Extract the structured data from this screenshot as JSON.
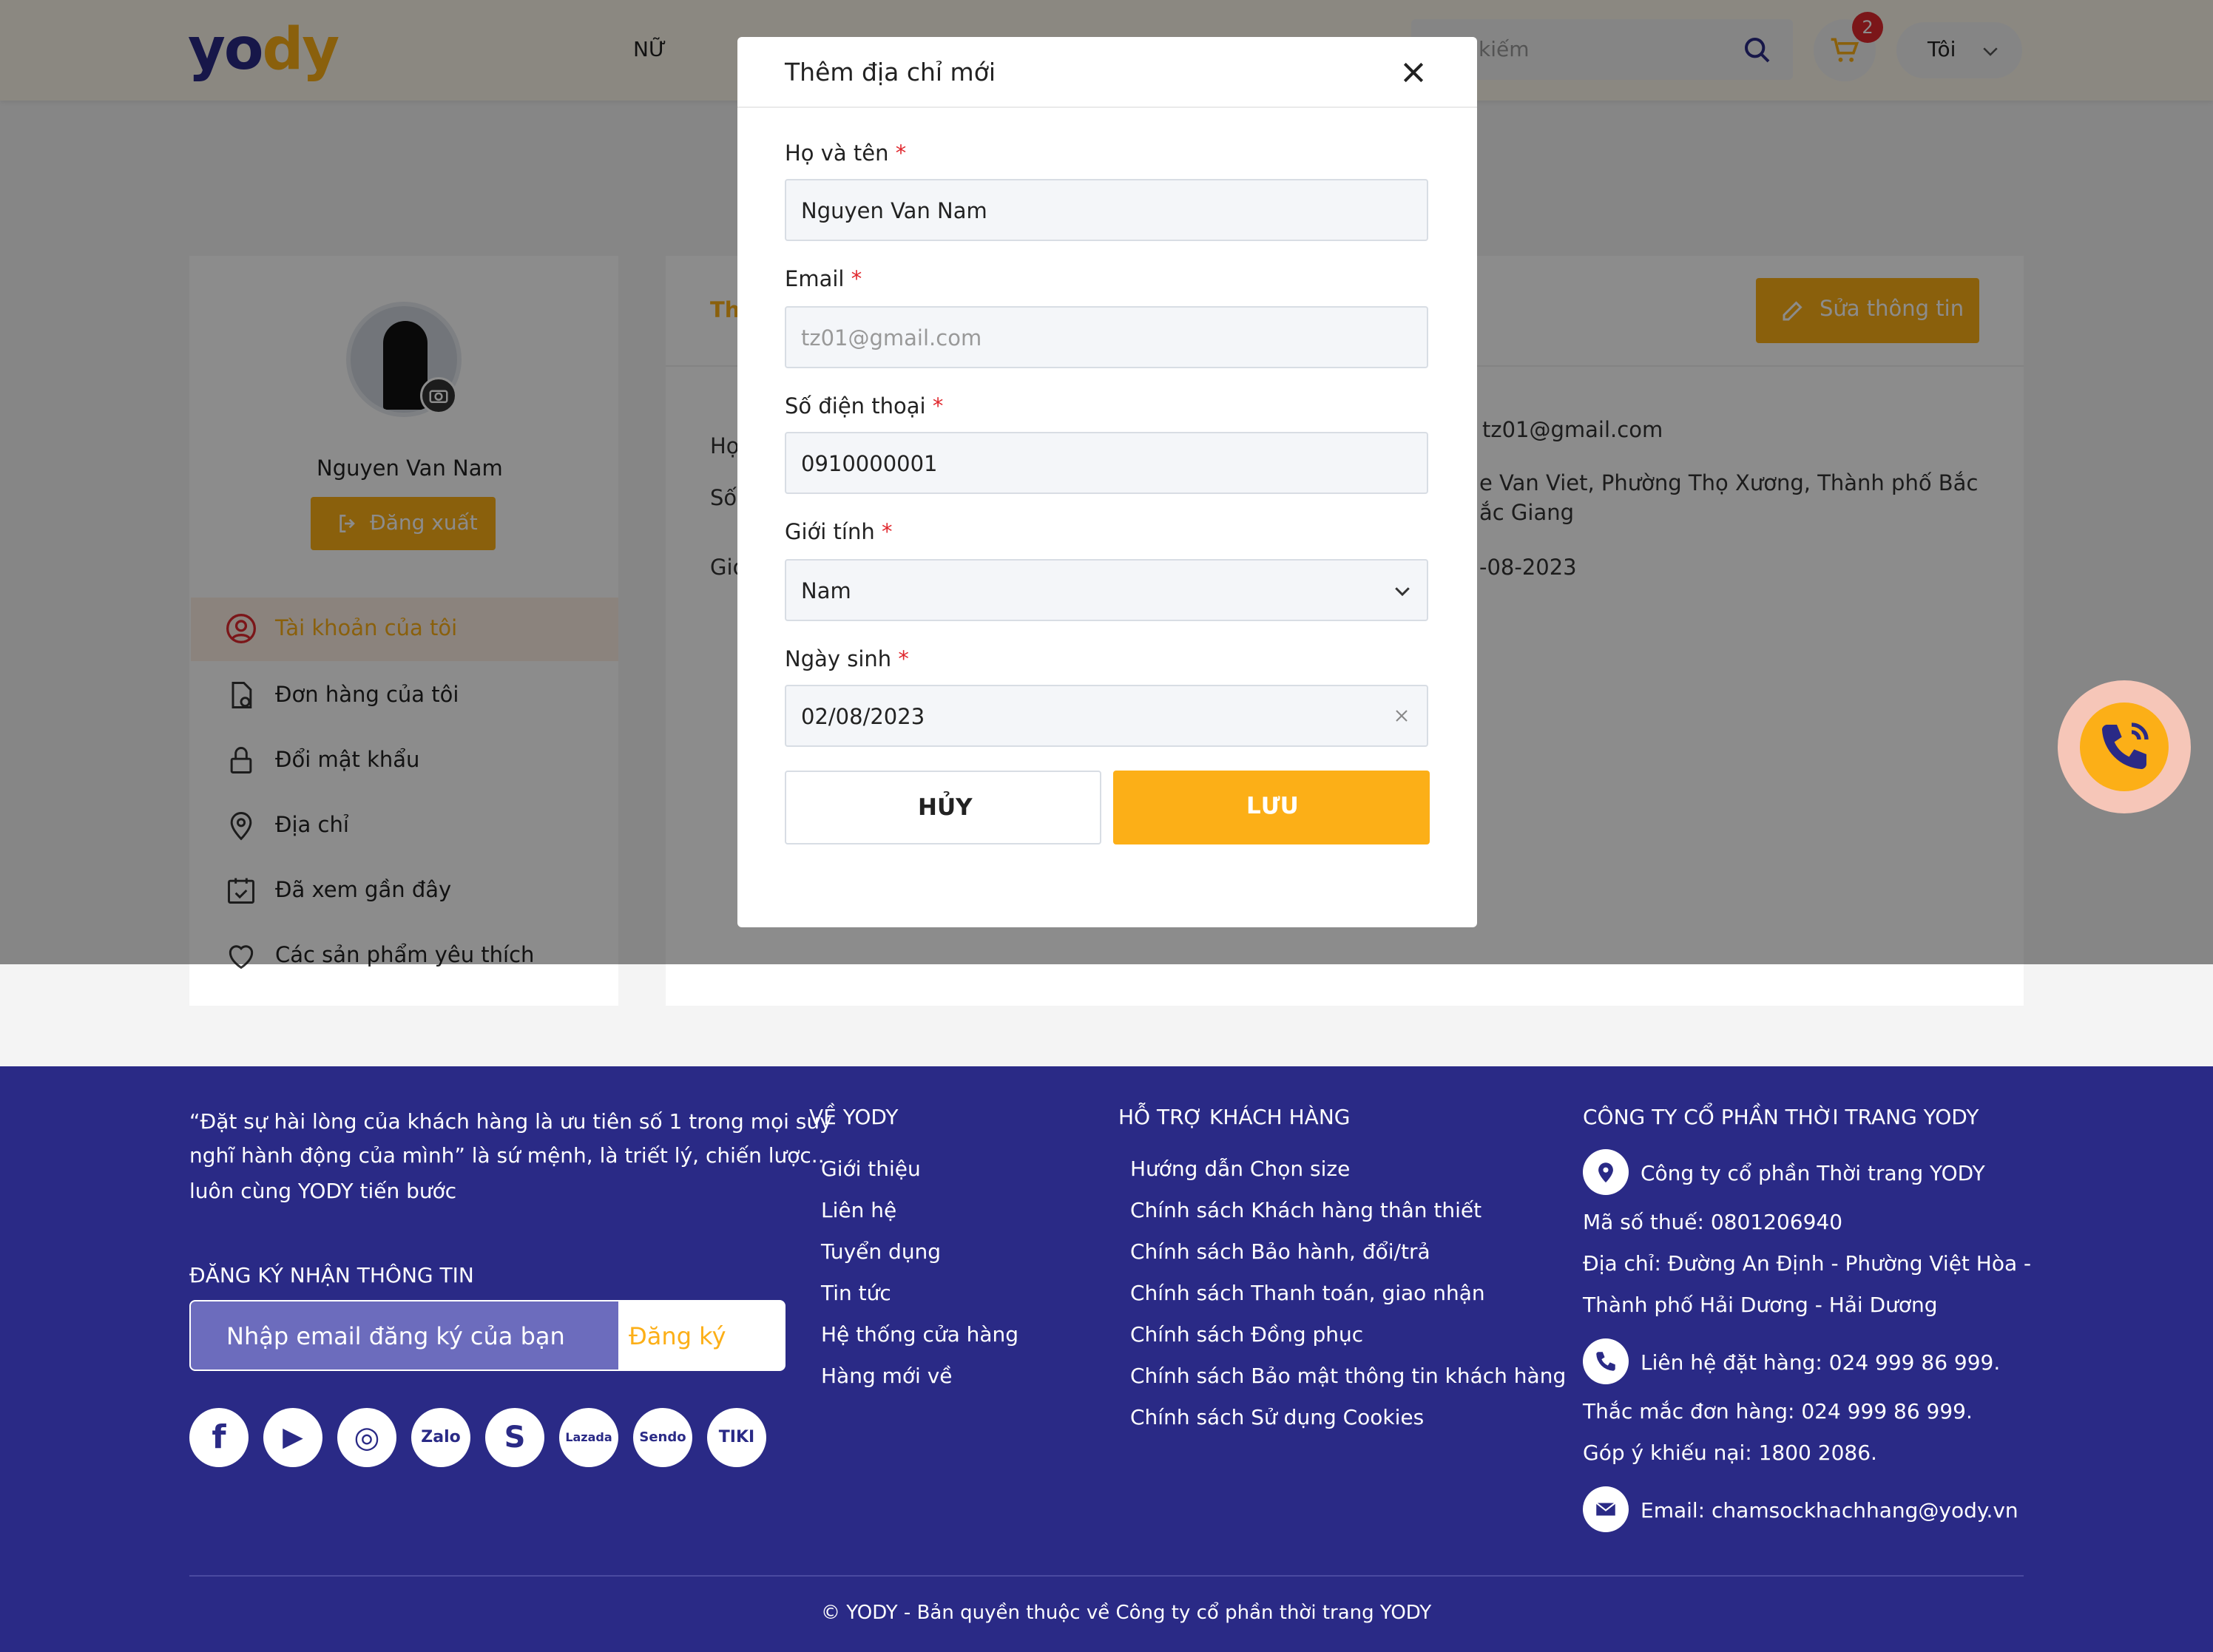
{
  "header": {
    "logo": "yody",
    "nav_nu": "NỮ",
    "search_placeholder": "Tìm kiếm",
    "cart_count": "2",
    "user_label": "Tôi"
  },
  "profile": {
    "name": "Nguyen Van Nam",
    "logout_label": "Đăng xuất",
    "menu": [
      {
        "label": "Tài khoản của tôi"
      },
      {
        "label": "Đơn hàng của tôi"
      },
      {
        "label": "Đổi mật khẩu"
      },
      {
        "label": "Địa chỉ"
      },
      {
        "label": "Đã xem gần đây"
      },
      {
        "label": "Các sản phẩm yêu thích"
      }
    ]
  },
  "info": {
    "tab_partial": "Th",
    "edit_label": "Sửa thông tin",
    "label_ho": "Họ",
    "label_so": "Số",
    "label_gioi": "Giớ",
    "email_value": "tz01@gmail.com",
    "address_line1": "e Van Viet, Phường Thọ Xương, Thành phố Bắc",
    "address_line2": "ắc Giang",
    "dob_partial": "-08-2023"
  },
  "modal": {
    "title": "Thêm địa chỉ mới",
    "fullname_label": "Họ và tên",
    "fullname_value": "Nguyen Van Nam",
    "email_label": "Email",
    "email_value": "tz01@gmail.com",
    "phone_label": "Số điện thoại",
    "phone_value": "0910000001",
    "gender_label": "Giới tính",
    "gender_value": "Nam",
    "dob_label": "Ngày sinh",
    "dob_value": "02/08/2023",
    "required_mark": "*",
    "cancel_label": "HỦY",
    "save_label": "LƯU"
  },
  "footer": {
    "quote": [
      "“Đặt sự hài lòng của khách hàng là ưu tiên số 1 trong mọi suy",
      "nghĩ hành động của mình” là sứ mệnh, là triết lý, chiến lược..",
      "luôn cùng YODY tiến bước"
    ],
    "newsletter_heading": "ĐĂNG KÝ NHẬN THÔNG TIN",
    "newsletter_placeholder": "Nhập email đăng ký của bạn",
    "newsletter_button": "Đăng ký",
    "social": [
      "f",
      "▶",
      "◎",
      "Zalo",
      "S",
      "Lazada",
      "Sendo",
      "TIKI"
    ],
    "about_heading": "VỀ YODY",
    "about_links": [
      "Giới thiệu",
      "Liên hệ",
      "Tuyển dụng",
      "Tin tức",
      "Hệ thống cửa hàng",
      "Hàng mới về"
    ],
    "support_heading": "HỖ TRỢ KHÁCH HÀNG",
    "support_links": [
      "Hướng dẫn Chọn size",
      "Chính sách Khách hàng thân thiết",
      "Chính sách Bảo hành, đổi/trả",
      "Chính sách Thanh toán, giao nhận",
      "Chính sách Đồng phục",
      "Chính sách Bảo mật thông tin khách hàng",
      "Chính sách Sử dụng Cookies"
    ],
    "company_heading": "CÔNG TY CỔ PHẦN THỜI TRANG YODY",
    "company_name": "Công ty cổ phần Thời trang YODY",
    "tax": "Mã số thuế: 0801206940",
    "address1": "Địa chỉ: Đường An Định - Phường Việt Hòa -",
    "address2": "Thành phố Hải Dương - Hải Dương",
    "hotline": "Liên hệ đặt hàng: 024 999 86 999.",
    "order_q": "Thắc mắc đơn hàng: 024 999 86 999.",
    "complaint": "Góp ý khiếu nại: 1800 2086.",
    "email": "Email: chamsockhachhang@yody.vn",
    "copyright": "© YODY - Bản quyền thuộc về Công ty cổ phần thời trang YODY"
  },
  "colors": {
    "brand_navy": "#2a2a86",
    "brand_yellow": "#fcaf17",
    "required_red": "#e0282e"
  }
}
